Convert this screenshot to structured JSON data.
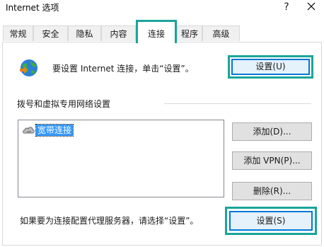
{
  "window": {
    "title": "Internet 选项",
    "help_glyph": "?",
    "close_glyph": "✕"
  },
  "tabs": [
    {
      "label": "常规",
      "active": false
    },
    {
      "label": "安全",
      "active": false
    },
    {
      "label": "隐私",
      "active": false
    },
    {
      "label": "内容",
      "active": false
    },
    {
      "label": "连接",
      "active": true
    },
    {
      "label": "程序",
      "active": false
    },
    {
      "label": "高级",
      "active": false
    }
  ],
  "setup": {
    "text": "要设置 Internet 连接，单击“设置”。",
    "button": "设置(U)",
    "icon": "internet-globe-icon"
  },
  "dialup": {
    "group_label": "拨号和虚拟专用网络设置",
    "connections": [
      {
        "label": "宽带连接",
        "icon": "broadband-connection-icon",
        "selected": true
      }
    ],
    "add_button": "添加(D)...",
    "add_vpn_button": "添加 VPN(P)...",
    "remove_button": "删除(R)..."
  },
  "proxy": {
    "text": "如果要为连接配置代理服务器，请选择“设置”。",
    "button": "设置(S)"
  },
  "colors": {
    "highlight_frame": "#1aa59a",
    "focus_border": "#0078d7",
    "selection": "#3399ff"
  }
}
